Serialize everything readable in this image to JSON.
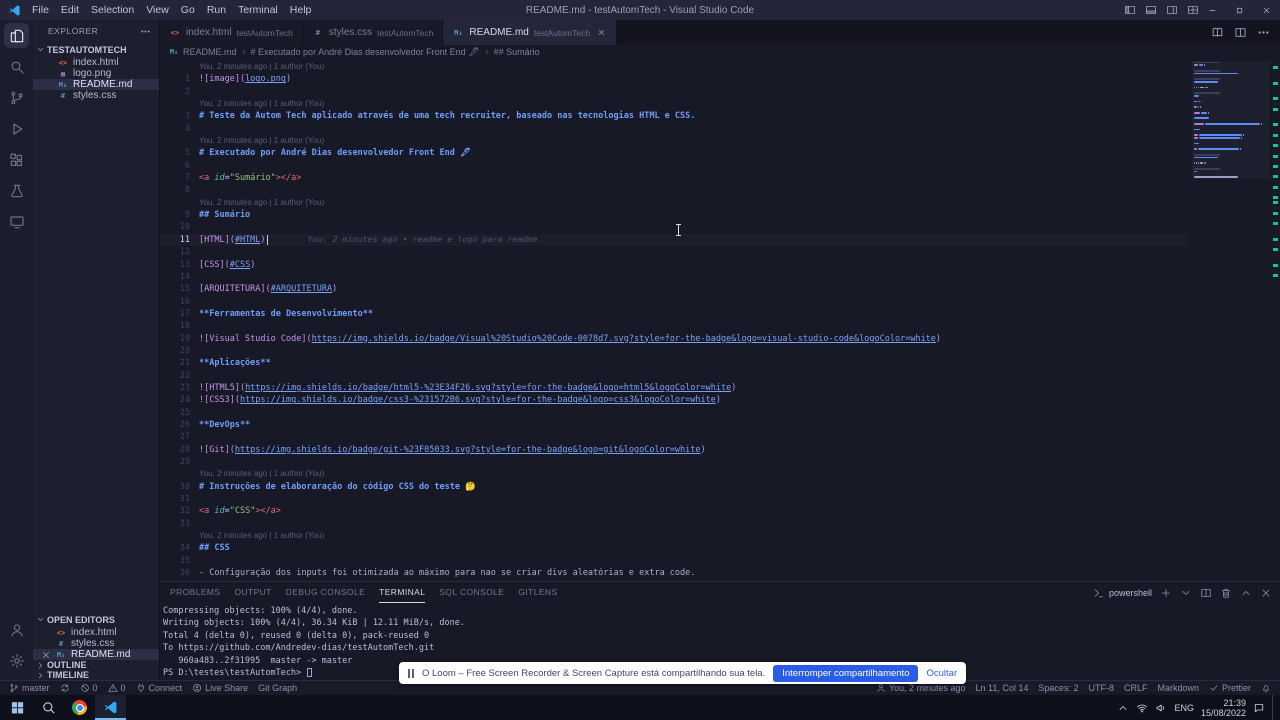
{
  "colors": {
    "titlebar_bg": "#24253a",
    "activitybar_bg": "#1b1c2c",
    "sidebar_bg": "#1e1f2e",
    "editor_bg": "#181926",
    "tabstrip_bg": "#131420",
    "tab_active_bg": "#252639",
    "statusbar_bg": "#191a28",
    "taskbar_bg": "#0d0f1b",
    "heading": "#6f9ef8",
    "link": "#c792ea",
    "url": "#7aa2f7",
    "tag": "#e06c75",
    "attr": "#56b6c2",
    "string": "#98c379",
    "terminal_fg": "#b9bfe3",
    "accent": "#2fa9f3",
    "loom_blue": "#2b5ce6",
    "git_decoration": "#1fbf9a"
  },
  "titlebar": {
    "menus": [
      "File",
      "Edit",
      "Selection",
      "View",
      "Go",
      "Run",
      "Terminal",
      "Help"
    ],
    "title": "README.md - testAutomTech - Visual Studio Code"
  },
  "activitybar": {
    "top": [
      {
        "id": "explorer",
        "active": true
      },
      {
        "id": "search"
      },
      {
        "id": "source-control"
      },
      {
        "id": "run-debug"
      },
      {
        "id": "extensions"
      },
      {
        "id": "testing"
      },
      {
        "id": "remote-explorer"
      }
    ],
    "bottom": [
      {
        "id": "accounts"
      },
      {
        "id": "settings"
      }
    ]
  },
  "sidebar": {
    "title": "EXPLORER",
    "root": "TESTAUTOMTECH",
    "files": [
      {
        "label": "index.html",
        "type": "html"
      },
      {
        "label": "logo.png",
        "type": "img"
      },
      {
        "label": "README.md",
        "type": "md",
        "selected": true
      },
      {
        "label": "styles.css",
        "type": "css"
      }
    ],
    "open_editors_title": "OPEN EDITORS",
    "open_editors": [
      {
        "label": "index.html",
        "type": "html"
      },
      {
        "label": "styles.css",
        "type": "css"
      },
      {
        "label": "README.md",
        "type": "md",
        "active": true
      }
    ],
    "sections": [
      "OUTLINE",
      "TIMELINE"
    ]
  },
  "tabs": [
    {
      "file": "index.html",
      "desc": "testAutomTech",
      "type": "html"
    },
    {
      "file": "styles.css",
      "desc": "testAutomTech",
      "type": "css"
    },
    {
      "file": "README.md",
      "desc": "testAutomTech",
      "type": "md",
      "active": true
    }
  ],
  "breadcrumbs": [
    "README.md",
    "# Executado por André Dias desenvolvedor Front End 🖋",
    "## Sumário"
  ],
  "editor": {
    "codelens": "You, 2 minutes ago | 1 author (You)",
    "blame": "You, 2 minutes ago • readme e logo para readme",
    "cursor_line": 11,
    "rows": [
      {
        "k": "lens"
      },
      {
        "k": "c",
        "n": 1,
        "s": [
          [
            "![image](",
            "lt"
          ],
          [
            "logo.png",
            "lu"
          ],
          [
            ")",
            "lt"
          ]
        ]
      },
      {
        "k": "b",
        "n": 2
      },
      {
        "k": "lens"
      },
      {
        "k": "c",
        "n": 3,
        "s": [
          [
            "# Teste da Autom Tech aplicado através de uma tech recruiter, baseado nas tecnologias HTML e CSS.",
            "h"
          ]
        ]
      },
      {
        "k": "b",
        "n": 4
      },
      {
        "k": "lens"
      },
      {
        "k": "c",
        "n": 5,
        "s": [
          [
            "# Executado por André Dias desenvolvedor Front End 🖋",
            "h"
          ]
        ]
      },
      {
        "k": "b",
        "n": 6
      },
      {
        "k": "c",
        "n": 7,
        "s": [
          [
            "<a ",
            "tag"
          ],
          [
            "id",
            "attr"
          ],
          [
            "=",
            "eq"
          ],
          [
            "\"Sumário\"",
            "str"
          ],
          [
            "></a>",
            "tag"
          ]
        ]
      },
      {
        "k": "b",
        "n": 8
      },
      {
        "k": "lens"
      },
      {
        "k": "c",
        "n": 9,
        "s": [
          [
            "## Sumário",
            "h"
          ]
        ]
      },
      {
        "k": "b",
        "n": 10
      },
      {
        "k": "c",
        "n": 11,
        "blame": true,
        "s": [
          [
            "[HTML](",
            "lt"
          ],
          [
            "#HTML",
            "lu"
          ],
          [
            ")",
            "lt"
          ]
        ]
      },
      {
        "k": "b",
        "n": 12
      },
      {
        "k": "c",
        "n": 13,
        "s": [
          [
            "[CSS](",
            "lt"
          ],
          [
            "#CSS",
            "lu"
          ],
          [
            ")",
            "lt"
          ]
        ]
      },
      {
        "k": "b",
        "n": 14
      },
      {
        "k": "c",
        "n": 15,
        "s": [
          [
            "[ARQUITETURA](",
            "lt"
          ],
          [
            "#ARQUITETURA",
            "lu"
          ],
          [
            ")",
            "lt"
          ]
        ]
      },
      {
        "k": "b",
        "n": 16
      },
      {
        "k": "c",
        "n": 17,
        "s": [
          [
            "**Ferramentas de Desenvolvimento**",
            "h"
          ]
        ]
      },
      {
        "k": "b",
        "n": 18
      },
      {
        "k": "c",
        "n": 19,
        "s": [
          [
            "![Visual Studio Code](",
            "lt"
          ],
          [
            "https://img.shields.io/badge/Visual%20Studio%20Code-0078d7.svg?style=for-the-badge&logo=visual-studio-code&logoColor=white",
            "lu"
          ],
          [
            ")",
            "lt"
          ]
        ]
      },
      {
        "k": "b",
        "n": 20
      },
      {
        "k": "c",
        "n": 21,
        "s": [
          [
            "**Aplicações**",
            "h"
          ]
        ]
      },
      {
        "k": "b",
        "n": 22
      },
      {
        "k": "c",
        "n": 23,
        "s": [
          [
            "![HTML5](",
            "lt"
          ],
          [
            "https://img.shields.io/badge/html5-%23E34F26.svg?style=for-the-badge&logo=html5&logoColor=white",
            "lu"
          ],
          [
            ")",
            "lt"
          ]
        ]
      },
      {
        "k": "c",
        "n": 24,
        "s": [
          [
            "![CSS3](",
            "lt"
          ],
          [
            "https://img.shields.io/badge/css3-%231572B6.svg?style=for-the-badge&logo=css3&logoColor=white",
            "lu"
          ],
          [
            ")",
            "lt"
          ]
        ]
      },
      {
        "k": "b",
        "n": 25
      },
      {
        "k": "c",
        "n": 26,
        "s": [
          [
            "**DevOps**",
            "h"
          ]
        ]
      },
      {
        "k": "b",
        "n": 27
      },
      {
        "k": "c",
        "n": 28,
        "s": [
          [
            "![Git](",
            "lt"
          ],
          [
            "https://img.shields.io/badge/git-%23F05033.svg?style=for-the-badge&logo=git&logoColor=white",
            "lu"
          ],
          [
            ")",
            "lt"
          ]
        ]
      },
      {
        "k": "b",
        "n": 29
      },
      {
        "k": "lens"
      },
      {
        "k": "c",
        "n": 30,
        "s": [
          [
            "# Instruções de elaboraração do código CSS do teste 🤔",
            "h"
          ]
        ]
      },
      {
        "k": "b",
        "n": 31
      },
      {
        "k": "c",
        "n": 32,
        "s": [
          [
            "<a ",
            "tag"
          ],
          [
            "id",
            "attr"
          ],
          [
            "=",
            "eq"
          ],
          [
            "\"CSS\"",
            "str"
          ],
          [
            "></a>",
            "tag"
          ]
        ]
      },
      {
        "k": "b",
        "n": 33
      },
      {
        "k": "lens"
      },
      {
        "k": "c",
        "n": 34,
        "s": [
          [
            "## CSS",
            "h"
          ]
        ]
      },
      {
        "k": "b",
        "n": 35
      },
      {
        "k": "c",
        "n": 36,
        "s": [
          [
            "- Configuração dos inputs foi otimizada ao máximo para nao se criar divs aleatórias e extra code.",
            "pt"
          ]
        ]
      }
    ]
  },
  "panel": {
    "tabs": [
      "PROBLEMS",
      "OUTPUT",
      "DEBUG CONSOLE",
      "TERMINAL",
      "SQL CONSOLE",
      "GITLENS"
    ],
    "active_tab": "TERMINAL",
    "shell": "powershell",
    "terminal": [
      "Compressing objects: 100% (4/4), done.",
      "Writing objects: 100% (4/4), 36.34 KiB | 12.11 MiB/s, done.",
      "Total 4 (delta 0), reused 0 (delta 0), pack-reused 0",
      "To https://github.com/Andredev-dias/testAutomTech.git",
      "   960a483..2f31995  master -> master",
      "PS D:\\testes\\testAutomTech> "
    ]
  },
  "loom": {
    "message": "O Loom – Free Screen Recorder & Screen Capture está compartilhando sua tela.",
    "stop": "Interromper compartilhamento",
    "hide": "Ocultar"
  },
  "statusbar": {
    "left": [
      {
        "icon": "branch",
        "label": "master",
        "name": "branch"
      },
      {
        "icon": "sync",
        "label": "",
        "name": "sync"
      },
      {
        "icon": "error",
        "label": "0",
        "name": "errors"
      },
      {
        "icon": "warning",
        "label": "0",
        "name": "warnings"
      },
      {
        "icon": "connect",
        "label": "Connect",
        "name": "connect"
      },
      {
        "icon": "liveshare",
        "label": "Live Share",
        "name": "live-share"
      },
      {
        "icon": "",
        "label": "Git Graph",
        "name": "git-graph"
      }
    ],
    "right": [
      {
        "icon": "person",
        "label": "You, 2 minutes ago",
        "name": "gitlens-blame"
      },
      {
        "icon": "",
        "label": "Ln 11, Col 14",
        "name": "cursor-position"
      },
      {
        "icon": "",
        "label": "Spaces: 2",
        "name": "indentation"
      },
      {
        "icon": "",
        "label": "UTF-8",
        "name": "encoding"
      },
      {
        "icon": "",
        "label": "CRLF",
        "name": "eol"
      },
      {
        "icon": "",
        "label": "Markdown",
        "name": "language-mode"
      },
      {
        "icon": "check",
        "label": "Prettier",
        "name": "formatter"
      },
      {
        "icon": "bell",
        "label": "",
        "name": "notifications"
      }
    ]
  },
  "taskbar": {
    "apps": [
      {
        "id": "start",
        "name": "start-button"
      },
      {
        "id": "search-circle",
        "name": "search-button"
      },
      {
        "id": "chrome",
        "name": "chrome-app"
      },
      {
        "id": "vscode",
        "name": "vscode-app",
        "active": true
      }
    ],
    "lang": "ENG",
    "time": "21:39",
    "date": "15/08/2022"
  }
}
